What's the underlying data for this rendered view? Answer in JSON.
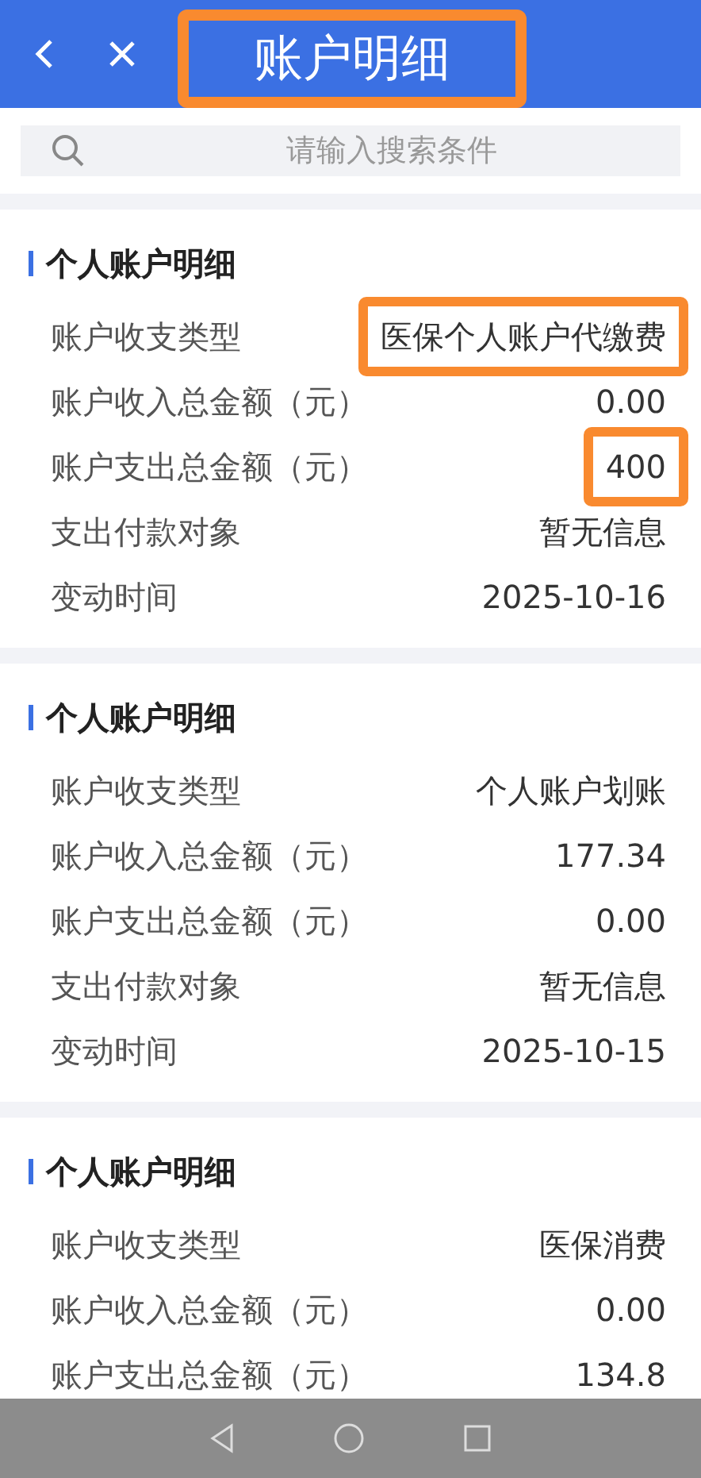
{
  "header": {
    "title": "账户明细",
    "title_highlighted": true
  },
  "search": {
    "placeholder": "请输入搜索条件"
  },
  "cards": [
    {
      "title": "个人账户明细",
      "rows": [
        {
          "label": "账户收支类型",
          "value": "医保个人账户代缴费",
          "highlighted": true
        },
        {
          "label": "账户收入总金额（元）",
          "value": "0.00",
          "highlighted": false
        },
        {
          "label": "账户支出总金额（元）",
          "value": "400",
          "highlighted": true
        },
        {
          "label": "支出付款对象",
          "value": "暂无信息",
          "highlighted": false
        },
        {
          "label": "变动时间",
          "value": "2025-10-16",
          "highlighted": false
        }
      ]
    },
    {
      "title": "个人账户明细",
      "rows": [
        {
          "label": "账户收支类型",
          "value": "个人账户划账",
          "highlighted": false
        },
        {
          "label": "账户收入总金额（元）",
          "value": "177.34",
          "highlighted": false
        },
        {
          "label": "账户支出总金额（元）",
          "value": "0.00",
          "highlighted": false
        },
        {
          "label": "支出付款对象",
          "value": "暂无信息",
          "highlighted": false
        },
        {
          "label": "变动时间",
          "value": "2025-10-15",
          "highlighted": false
        }
      ]
    },
    {
      "title": "个人账户明细",
      "rows": [
        {
          "label": "账户收支类型",
          "value": "医保消费",
          "highlighted": false
        },
        {
          "label": "账户收入总金额（元）",
          "value": "0.00",
          "highlighted": false
        },
        {
          "label": "账户支出总金额（元）",
          "value": "134.8",
          "highlighted": false
        }
      ]
    }
  ]
}
